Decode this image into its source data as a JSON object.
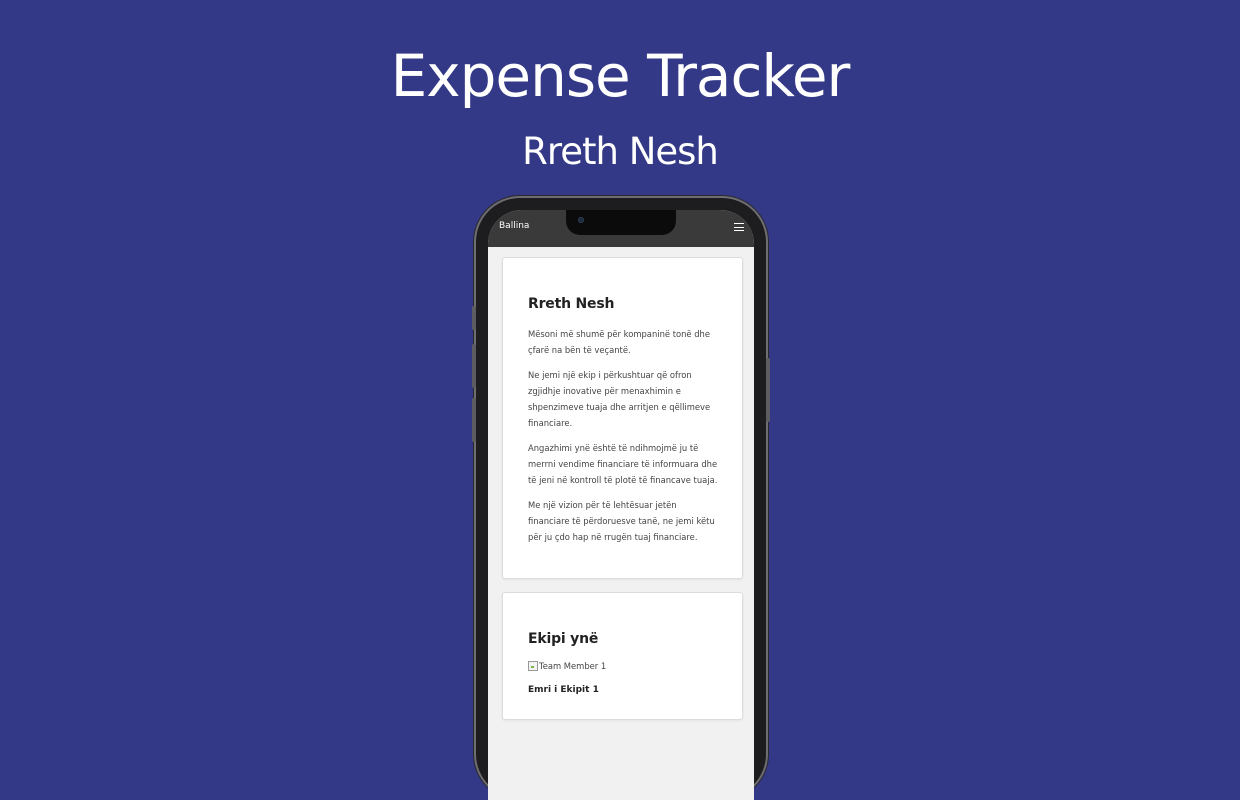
{
  "page": {
    "title": "Expense Tracker",
    "subtitle": "Rreth Nesh"
  },
  "navbar": {
    "brand": "Ballina",
    "menu_icon": "hamburger-menu-icon"
  },
  "about": {
    "heading": "Rreth Nesh",
    "paragraphs": [
      "Mësoni më shumë për kompaninë tonë dhe çfarë na bën të veçantë.",
      "Ne jemi një ekip i përkushtuar që ofron zgjidhje inovative për menaxhimin e shpenzimeve tuaja dhe arritjen e qëllimeve financiare.",
      "Angazhimi ynë është të ndihmojmë ju të merrni vendime financiare të informuara dhe të jeni në kontroll të plotë të financave tuaja.",
      "Me një vizion për të lehtësuar jetën financiare të përdoruesve tanë, ne jemi këtu për ju çdo hap në rrugën tuaj financiare."
    ]
  },
  "team": {
    "heading": "Ekipi ynë",
    "members": [
      {
        "image_alt": "Team Member 1",
        "name": "Emri i Ekipit 1"
      }
    ]
  },
  "colors": {
    "background": "#333986",
    "navbar": "#3a3a3a",
    "screen": "#f1f1f1",
    "card": "#ffffff"
  }
}
